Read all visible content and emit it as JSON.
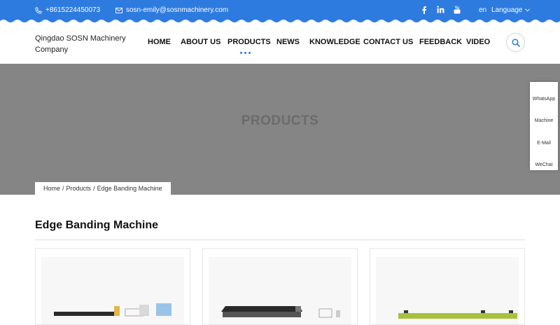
{
  "topbar": {
    "phone": "+8615224450073",
    "email": "sosn-emily@sosnmachinery.com",
    "social_icons": [
      "facebook-icon",
      "linkedin-icon",
      "youtube-icon"
    ],
    "lang_code": "en",
    "language_label": "Language"
  },
  "header": {
    "company_name": "Qingdao SOSN Machinery Company",
    "nav": [
      "HOME",
      "ABOUT US",
      "PRODUCTS",
      "NEWS",
      "KNOWLEDGE",
      "CONTACT US",
      "FEEDBACK",
      "VIDEO"
    ],
    "active_nav": "PRODUCTS"
  },
  "banner": {
    "title": "PRODUCTS"
  },
  "breadcrumb": {
    "home": "Home",
    "sep1": "/",
    "products": "Products",
    "sep2": "/",
    "current": "Edge Banding Machine"
  },
  "side_panel": [
    "WhatsApp",
    "Machine",
    "E-Mail",
    "WeChat"
  ],
  "section": {
    "title": "Edge Banding Machine"
  },
  "colors": {
    "accent": "#2e7be0",
    "banner": "#858585"
  }
}
